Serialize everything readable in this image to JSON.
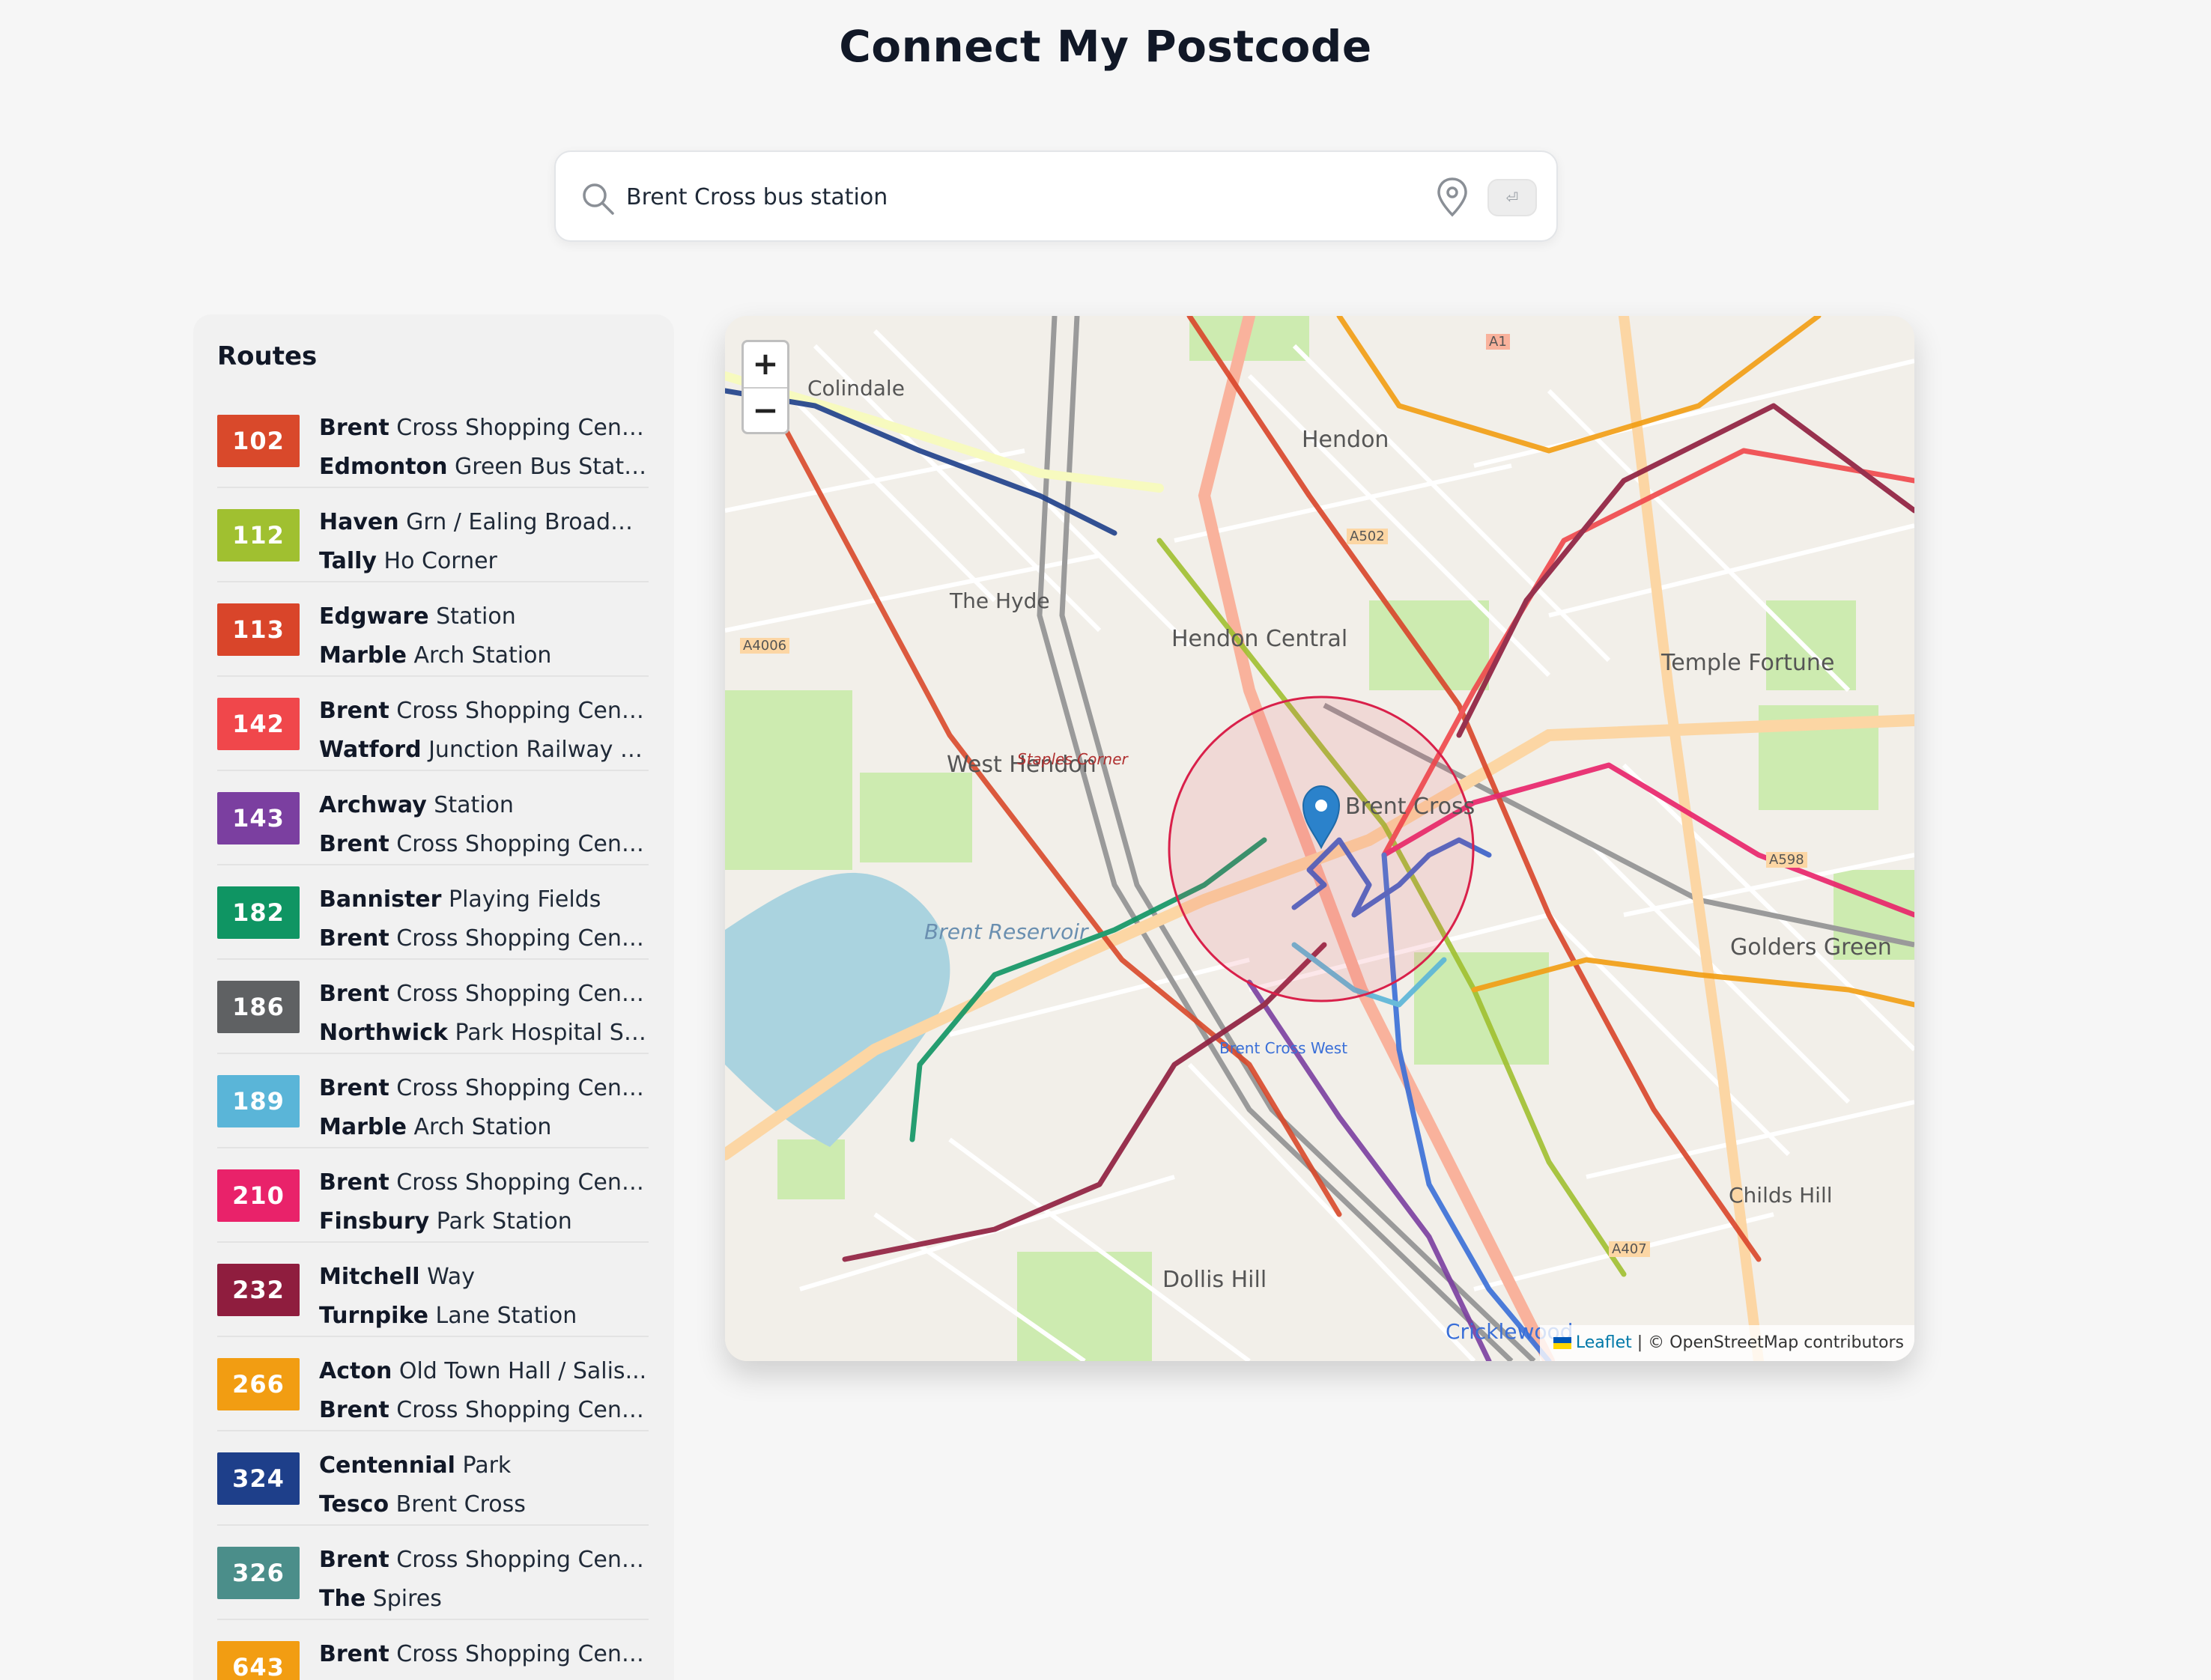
{
  "header": {
    "title": "Connect My Postcode"
  },
  "search": {
    "value": "Brent Cross bus station",
    "enter_label": "⏎"
  },
  "sidebar": {
    "title": "Routes",
    "routes": [
      {
        "number": "102",
        "color": "#d9492b",
        "from_bold": "Brent",
        "from_rest": " Cross Shopping Centre",
        "to_bold": "Edmonton",
        "to_rest": " Green Bus Station"
      },
      {
        "number": "112",
        "color": "#a0c030",
        "from_bold": "Haven",
        "from_rest": " Grn / Ealing Broadwa...",
        "to_bold": "Tally",
        "to_rest": " Ho Corner"
      },
      {
        "number": "113",
        "color": "#d9452a",
        "from_bold": "Edgware",
        "from_rest": " Station",
        "to_bold": "Marble",
        "to_rest": " Arch Station"
      },
      {
        "number": "142",
        "color": "#f0474b",
        "from_bold": "Brent",
        "from_rest": " Cross Shopping Centre",
        "to_bold": "Watford",
        "to_rest": " Junction Railway S..."
      },
      {
        "number": "143",
        "color": "#7b3fa0",
        "from_bold": "Archway",
        "from_rest": " Station",
        "to_bold": "Brent",
        "to_rest": " Cross Shopping Centre"
      },
      {
        "number": "182",
        "color": "#0f9563",
        "from_bold": "Bannister",
        "from_rest": " Playing Fields",
        "to_bold": "Brent",
        "to_rest": " Cross Shopping Centre"
      },
      {
        "number": "186",
        "color": "#5f6163",
        "from_bold": "Brent",
        "from_rest": " Cross Shopping Centre",
        "to_bold": "Northwick",
        "to_rest": " Park Hospital So..."
      },
      {
        "number": "189",
        "color": "#5ab5d8",
        "from_bold": "Brent",
        "from_rest": " Cross Shopping Centre",
        "to_bold": "Marble",
        "to_rest": " Arch Station"
      },
      {
        "number": "210",
        "color": "#e9226a",
        "from_bold": "Brent",
        "from_rest": " Cross Shopping Centre",
        "to_bold": "Finsbury",
        "to_rest": " Park Station"
      },
      {
        "number": "232",
        "color": "#8f1d3e",
        "from_bold": "Mitchell",
        "from_rest": " Way",
        "to_bold": "Turnpike",
        "to_rest": " Lane Station"
      },
      {
        "number": "266",
        "color": "#f29d12",
        "from_bold": "Acton",
        "from_rest": " Old Town Hall / Salis...",
        "to_bold": "Brent",
        "to_rest": " Cross Shopping Centre"
      },
      {
        "number": "324",
        "color": "#1e3f8a",
        "from_bold": "Centennial",
        "from_rest": " Park",
        "to_bold": "Tesco",
        "to_rest": " Brent Cross"
      },
      {
        "number": "326",
        "color": "#4b8e8a",
        "from_bold": "Brent",
        "from_rest": " Cross Shopping Centre",
        "to_bold": "The",
        "to_rest": " Spires"
      },
      {
        "number": "643",
        "color": "#f29d12",
        "from_bold": "Brent",
        "from_rest": " Cross Shopping Centre",
        "to_bold": "",
        "to_rest": ""
      }
    ]
  },
  "map": {
    "zoom_in": "+",
    "zoom_out": "−",
    "attribution_link": "Leaflet",
    "attribution_text": " | © OpenStreetMap contributors",
    "labels": {
      "colindale": "Colindale",
      "hendon": "Hendon",
      "hendon_central": "Hendon Central",
      "the_hyde": "The Hyde",
      "west_hendon": "West Hendon",
      "temple_fortune": "Temple Fortune",
      "brent_cross": "Brent Cross",
      "golders_green": "Golders Green",
      "dollis_hill": "Dollis Hill",
      "childs_hill": "Childs Hill",
      "cricklewood": "Cricklewood",
      "brent_reservoir": "Brent Reservoir",
      "brent_cross_west": "Brent Cross West",
      "staples_corner": "Staples Corner",
      "a502": "A502",
      "a4006": "A4006",
      "a598": "A598",
      "a407": "A407",
      "a1": "A1"
    }
  }
}
